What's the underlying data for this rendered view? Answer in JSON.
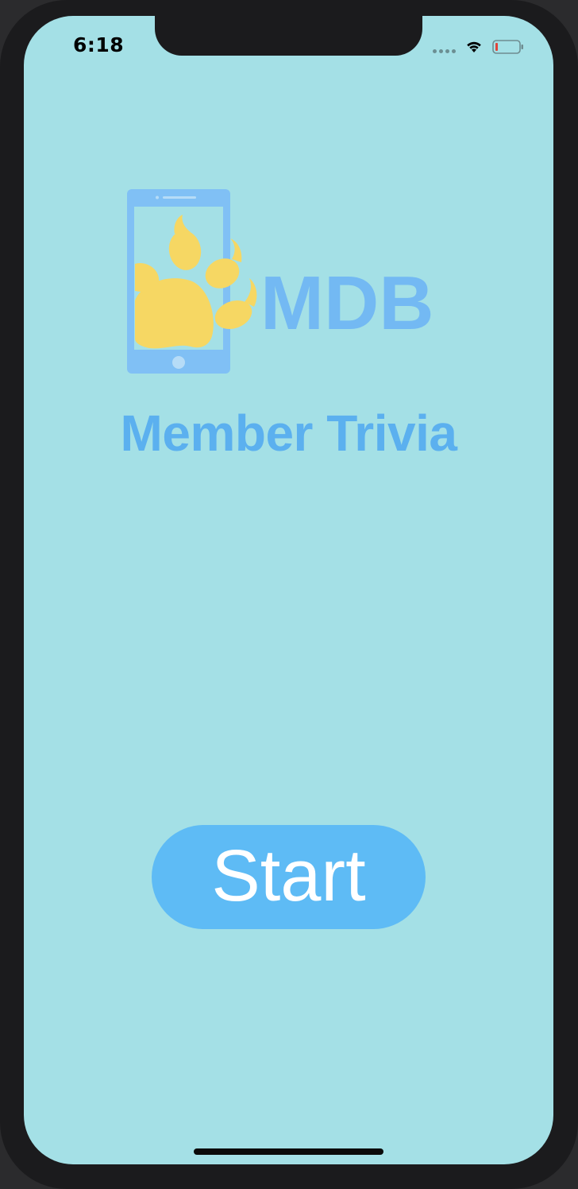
{
  "status_bar": {
    "time": "6:18",
    "signal_icon": "signal-dots-icon",
    "wifi_icon": "wifi-icon",
    "battery_icon": "battery-low-icon"
  },
  "logo": {
    "text": "MDB",
    "icon": "phone-paw-logo",
    "colors": {
      "phone": "#80c0f5",
      "paw": "#f6d763",
      "text": "#73b9f3"
    }
  },
  "title": "Member Trivia",
  "start_button": {
    "label": "Start"
  },
  "colors": {
    "background": "#a4e0e6",
    "accent": "#5ebbf5",
    "title": "#5bb0ef",
    "button_text": "#ffffff"
  }
}
